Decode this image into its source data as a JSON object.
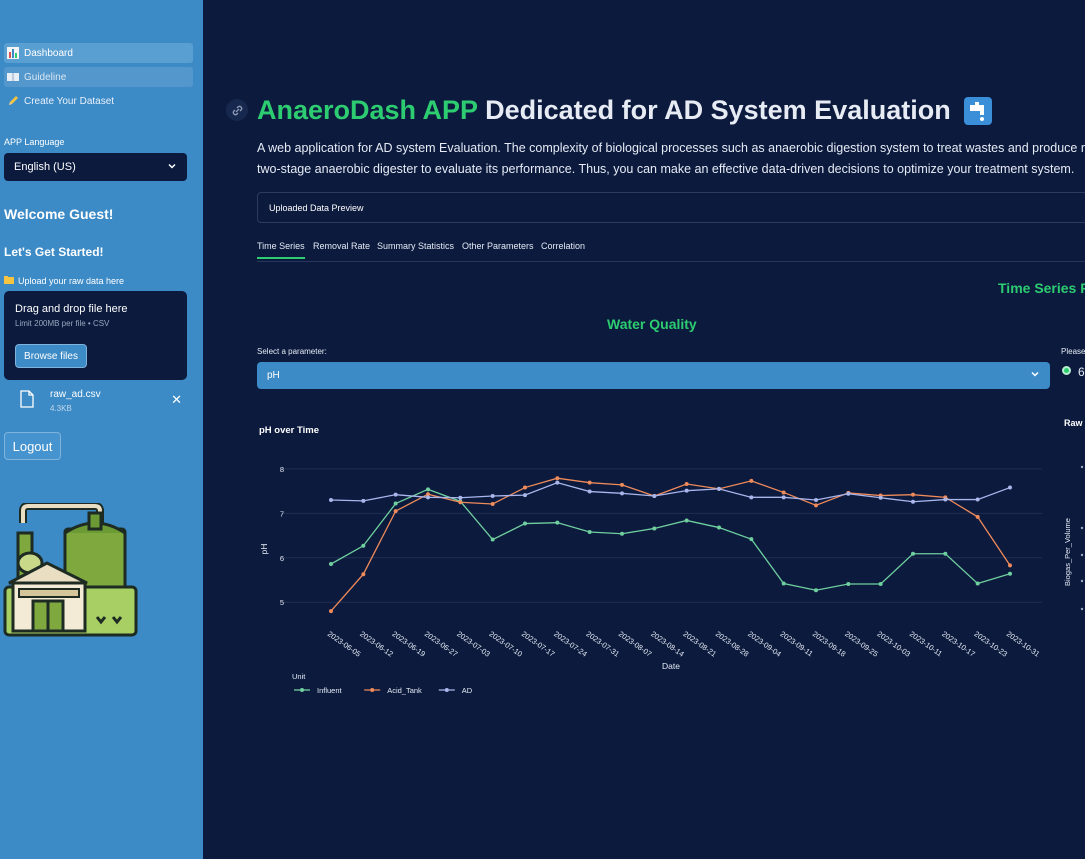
{
  "sidebar": {
    "nav": [
      {
        "label": "Dashboard",
        "icon": "chart-icon"
      },
      {
        "label": "Guideline",
        "icon": "book-icon"
      },
      {
        "label": "Create Your Dataset",
        "icon": "pencil-icon"
      }
    ],
    "language_label": "APP Language",
    "language_value": "English (US)",
    "welcome": "Welcome Guest!",
    "get_started": "Let's Get Started!",
    "upload_label": "Upload your raw data here",
    "upload_title": "Drag and drop file here",
    "upload_limit": "Limit 200MB per file • CSV",
    "browse_label": "Browse files",
    "file_name": "raw_ad.csv",
    "file_size": "4.3KB",
    "logout_label": "Logout"
  },
  "main": {
    "title_green": "AnaeroDash APP",
    "title_white": "Dedicated for AD System Evaluation",
    "desc_line1": "A web application for AD system Evaluation. The complexity of biological processes such as anaerobic digestion system to treat wastes and produce r",
    "desc_line2": "two-stage anaerobic digester to evaluate its performance. Thus, you can make an effective data-driven decisions to optimize your treatment system.",
    "expander_label": "Uploaded Data Preview",
    "tabs": [
      "Time Series",
      "Removal Rate",
      "Summary Statistics",
      "Other Parameters",
      "Correlation"
    ],
    "time_series_heading": "Time Series P",
    "water_quality_heading": "Water Quality",
    "select_param_label": "Select a parameter:",
    "param_value": "pH",
    "please_label": "Please",
    "radio_label": "6",
    "raw_label": "Raw",
    "right_y_label": "Biogas_Per_Volume"
  },
  "chart_data": {
    "type": "line",
    "title": "pH over Time",
    "xlabel": "Date",
    "ylabel": "pH",
    "ylim": [
      4.6,
      8.2
    ],
    "yticks": [
      5,
      6,
      7,
      8
    ],
    "legend_title": "Unit",
    "legend_position": "bottom-left",
    "x": [
      "2023-06-05",
      "2023-06-12",
      "2023-06-19",
      "2023-06-27",
      "2023-07-03",
      "2023-07-10",
      "2023-07-17",
      "2023-07-24",
      "2023-07-31",
      "2023-08-07",
      "2023-08-14",
      "2023-08-21",
      "2023-08-28",
      "2023-09-04",
      "2023-09-11",
      "2023-09-18",
      "2023-09-25",
      "2023-10-03",
      "2023-10-11",
      "2023-10-17",
      "2023-10-23",
      "2023-10-31"
    ],
    "series": [
      {
        "name": "Influent",
        "color": "#6fcf9f",
        "values": [
          5.86,
          6.27,
          7.22,
          7.54,
          7.27,
          6.41,
          6.77,
          6.79,
          6.58,
          6.54,
          6.66,
          6.84,
          6.68,
          6.42,
          5.42,
          5.27,
          5.41,
          5.41,
          6.09,
          6.09,
          5.42,
          5.64
        ]
      },
      {
        "name": "Acid_Tank",
        "color": "#ef8a5a",
        "values": [
          4.8,
          5.63,
          7.05,
          7.43,
          7.25,
          7.21,
          7.58,
          7.79,
          7.69,
          7.64,
          7.39,
          7.66,
          7.55,
          7.73,
          7.47,
          7.18,
          7.46,
          7.4,
          7.42,
          7.36,
          6.92,
          5.83
        ]
      },
      {
        "name": "AD",
        "color": "#a9b6ec",
        "values": [
          7.3,
          7.28,
          7.42,
          7.36,
          7.35,
          7.39,
          7.41,
          7.69,
          7.49,
          7.45,
          7.39,
          7.51,
          7.55,
          7.36,
          7.36,
          7.3,
          7.44,
          7.35,
          7.26,
          7.31,
          7.31,
          7.58
        ]
      }
    ]
  }
}
